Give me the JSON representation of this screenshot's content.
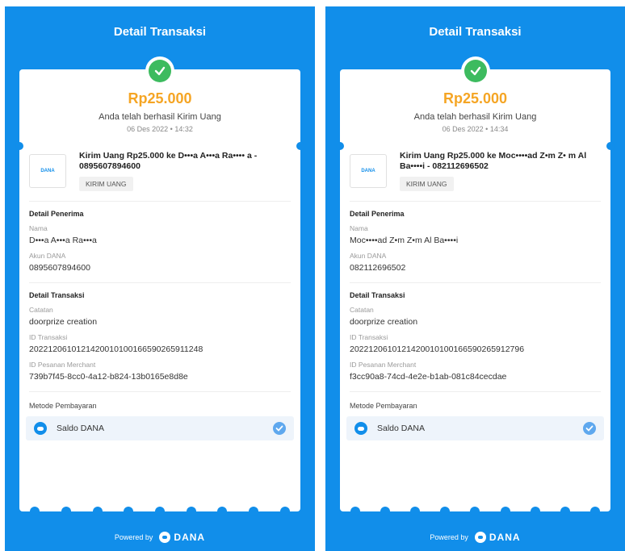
{
  "screens": [
    {
      "header": "Detail Transaksi",
      "amount": "Rp25.000",
      "subtitle": "Anda telah berhasil Kirim Uang",
      "datetime": "06 Des 2022 • 14:32",
      "item": {
        "logo": "DANA",
        "title": "Kirim Uang Rp25.000 ke D•••a A•••a Ra•••• a - 0895607894600",
        "tag": "KIRIM UANG"
      },
      "penerima": {
        "section": "Detail Penerima",
        "nama_label": "Nama",
        "nama": "D•••a A•••a Ra•••a",
        "akun_label": "Akun DANA",
        "akun": "0895607894600"
      },
      "transaksi": {
        "section": "Detail Transaksi",
        "catatan_label": "Catatan",
        "catatan": "doorprize creation",
        "id_label": "ID Transaksi",
        "id": "2022120610121420010100166590265911248",
        "merchant_label": "ID Pesanan Merchant",
        "merchant": "739b7f45-8cc0-4a12-b824-13b0165e8d8e"
      },
      "payment": {
        "label": "Metode Pembayaran",
        "method": "Saldo DANA"
      },
      "footer": {
        "powered": "Powered by",
        "brand": "DANA"
      }
    },
    {
      "header": "Detail Transaksi",
      "amount": "Rp25.000",
      "subtitle": "Anda telah berhasil Kirim Uang",
      "datetime": "06 Des 2022 • 14:34",
      "item": {
        "logo": "DANA",
        "title": "Kirim Uang Rp25.000 ke Moc••••ad Z•m Z• m Al Ba••••i - 082112696502",
        "tag": "KIRIM UANG"
      },
      "penerima": {
        "section": "Detail Penerima",
        "nama_label": "Nama",
        "nama": "Moc••••ad Z•m Z•m Al Ba••••i",
        "akun_label": "Akun DANA",
        "akun": "082112696502"
      },
      "transaksi": {
        "section": "Detail Transaksi",
        "catatan_label": "Catatan",
        "catatan": "doorprize creation",
        "id_label": "ID Transaksi",
        "id": "2022120610121420010100166590265912796",
        "merchant_label": "ID Pesanan Merchant",
        "merchant": "f3cc90a8-74cd-4e2e-b1ab-081c84cecdae"
      },
      "payment": {
        "label": "Metode Pembayaran",
        "method": "Saldo DANA"
      },
      "footer": {
        "powered": "Powered by",
        "brand": "DANA"
      }
    }
  ]
}
